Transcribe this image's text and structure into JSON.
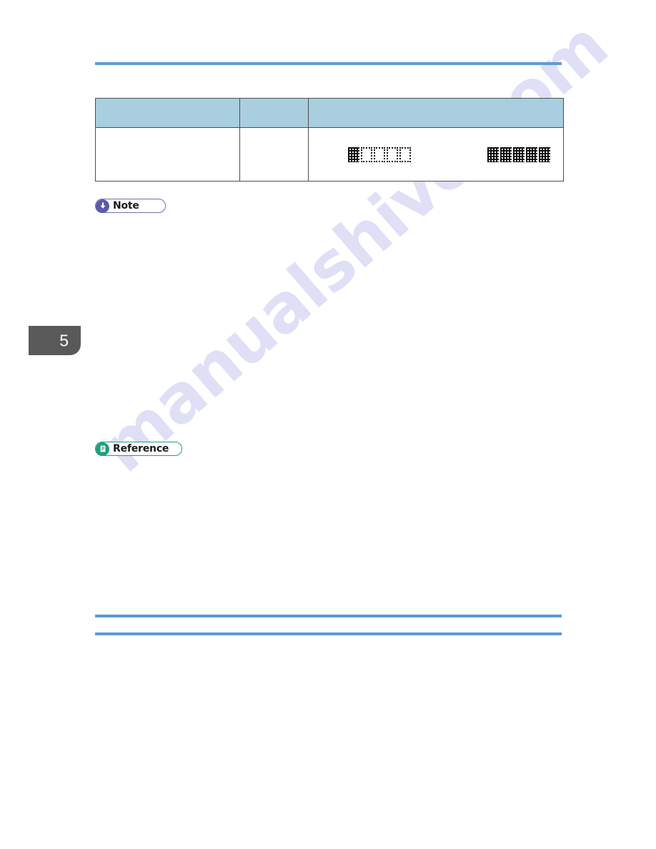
{
  "document": {
    "chapter_tab_number": "5",
    "watermark_text": "manualshive.com",
    "accent_rule_color": "#5b9bd5",
    "table_header_fill": "#a9cee0",
    "table_border_color": "#4d4d4d",
    "chapter_tab_fill": "#595959"
  },
  "table": {
    "columns": [
      {
        "header": ""
      },
      {
        "header": ""
      },
      {
        "header": ""
      }
    ],
    "rows": [
      {
        "cell_a": "",
        "cell_b": "",
        "cell_c_left_glyphs": [
          "dense",
          "hollow",
          "hollow",
          "hollow",
          "hollow"
        ],
        "cell_c_right_glyphs": [
          "dense",
          "dense",
          "dense",
          "dense",
          "dense"
        ]
      }
    ]
  },
  "callouts": [
    {
      "id": "note",
      "label": "Note",
      "icon": "down-arrow-icon",
      "icon_color": "#5b5ba8",
      "border_color": "#6f6fb5",
      "body": ""
    },
    {
      "id": "reference",
      "label": "Reference",
      "icon": "document-icon",
      "icon_color": "#1f9e7e",
      "border_color": "#1f9e7e",
      "body": ""
    }
  ]
}
